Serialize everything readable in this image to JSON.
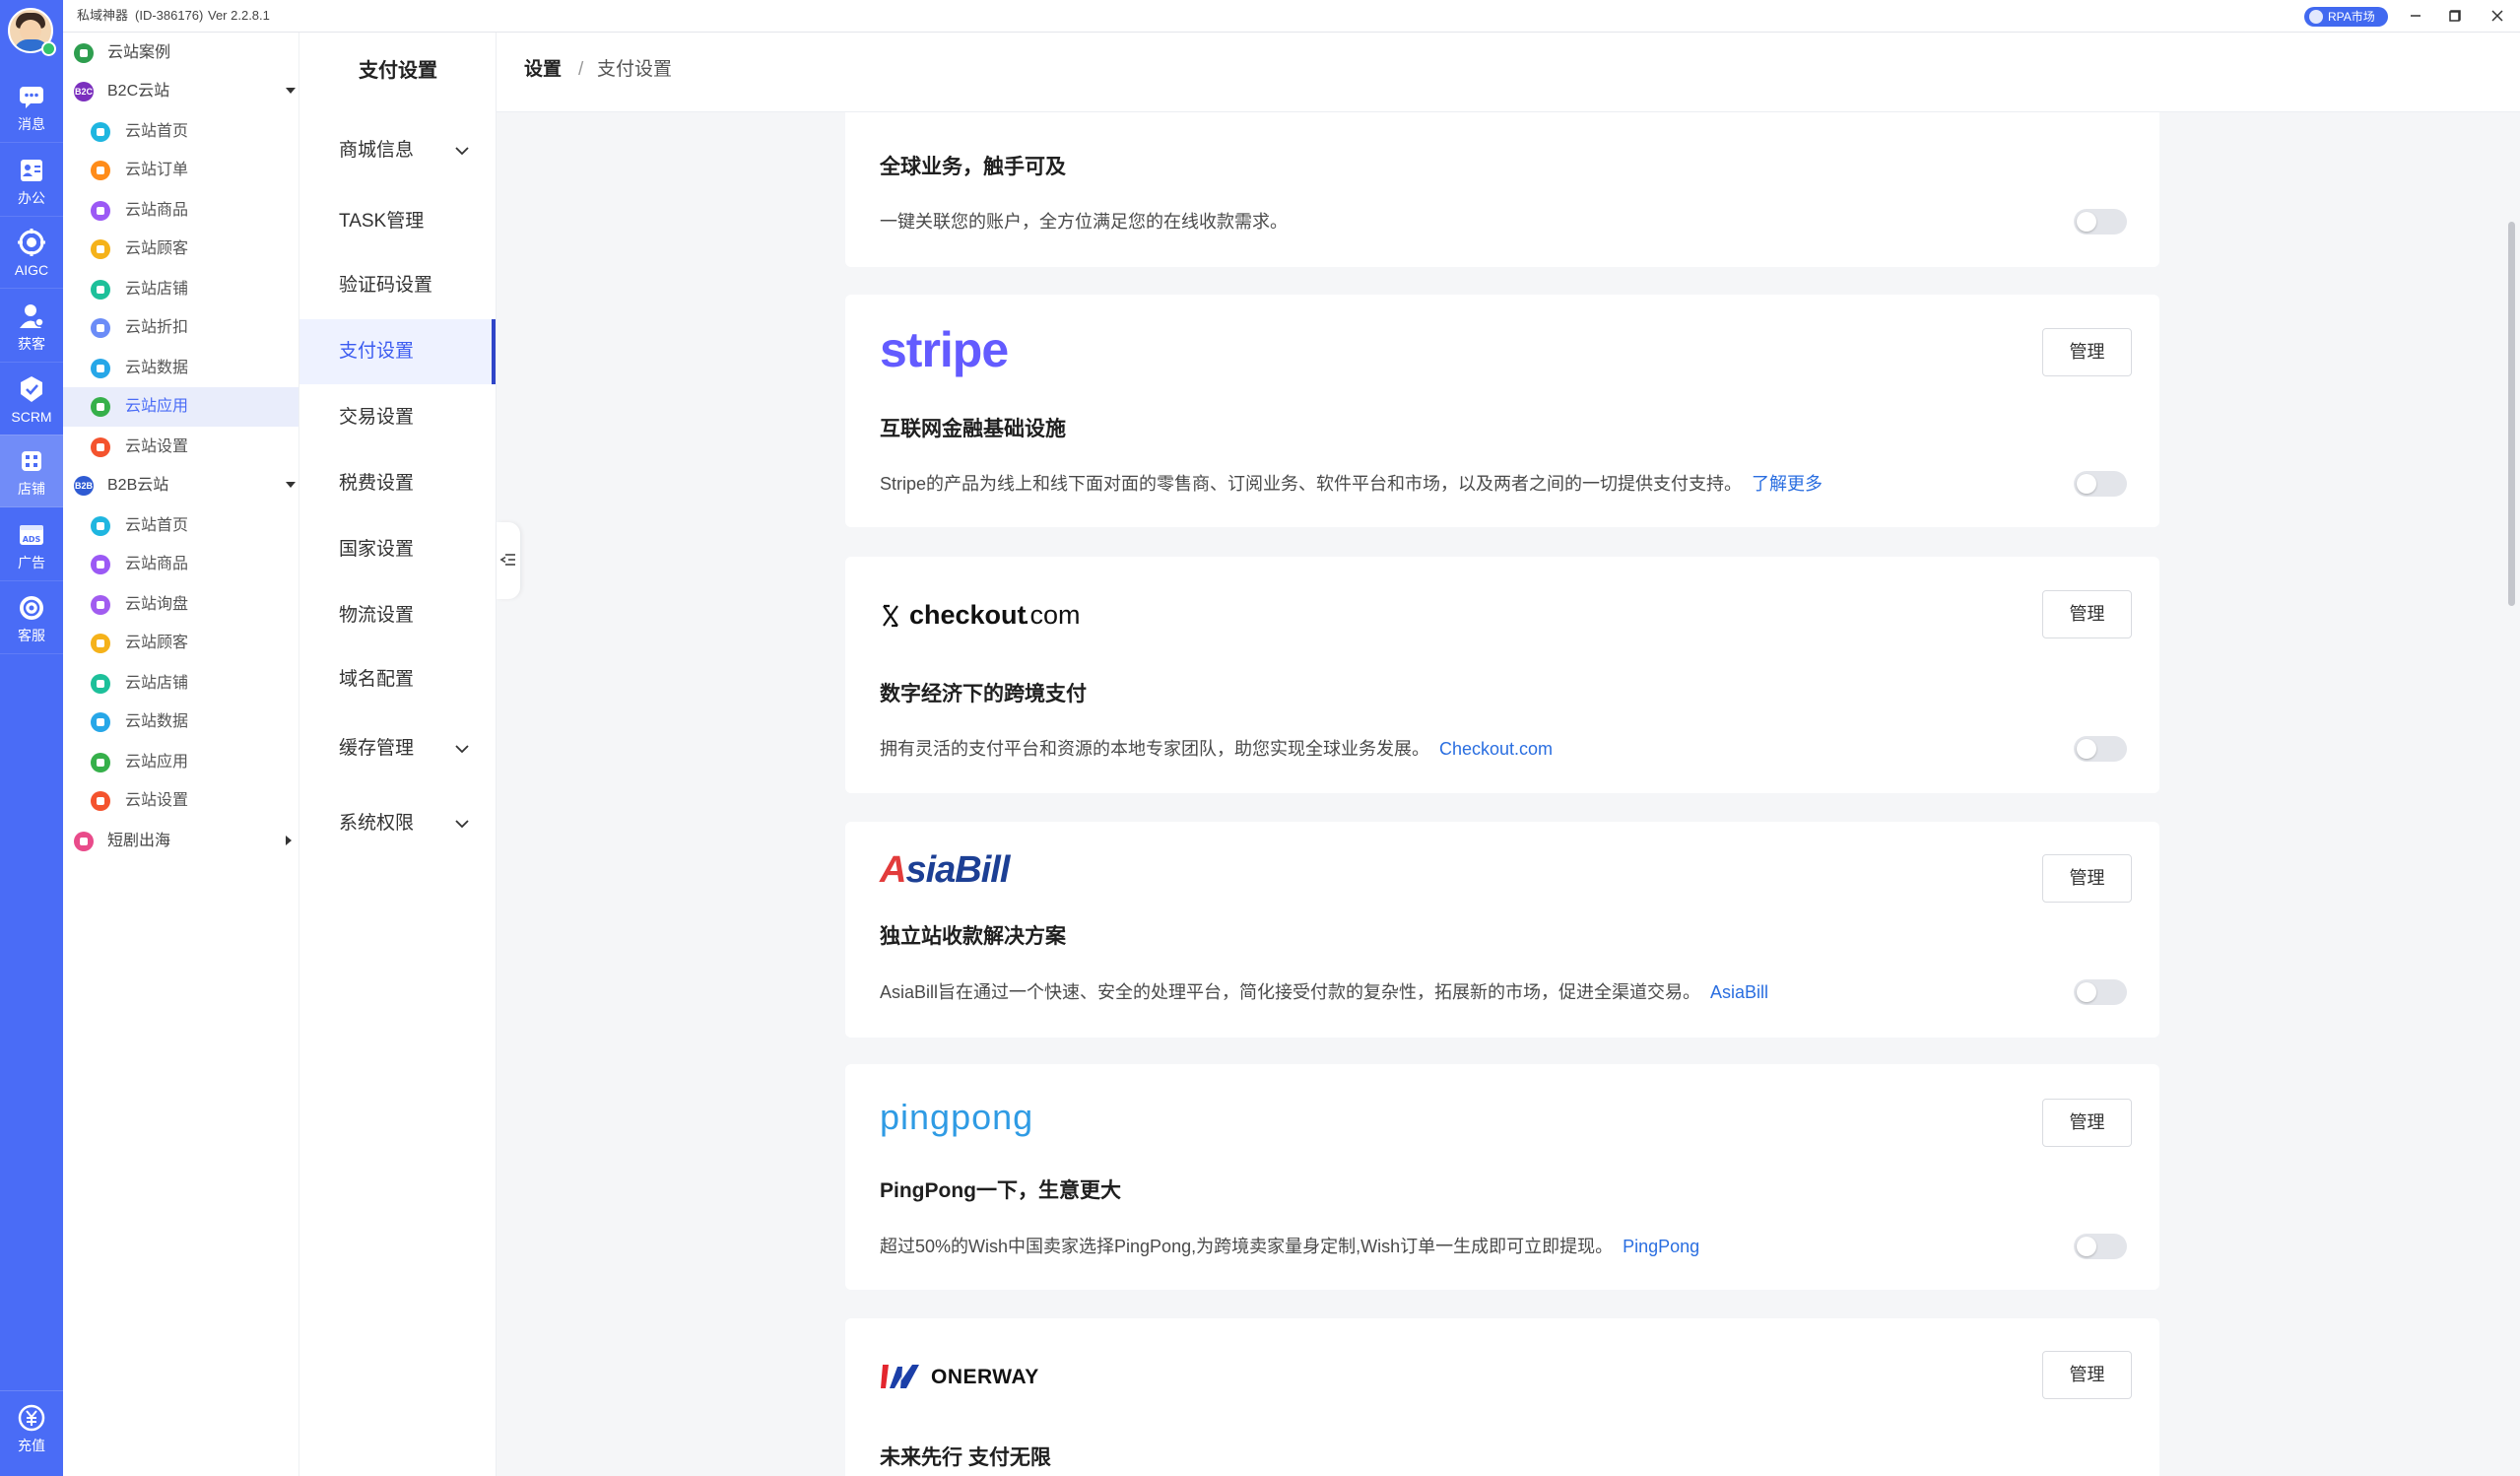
{
  "titlebar": {
    "app_name": "私域神器",
    "app_id": "(ID-386176)",
    "version": "Ver 2.2.8.1",
    "rpa_market": "RPA市场"
  },
  "icon_rail": {
    "items": [
      {
        "label": "消息",
        "icon": "message-icon"
      },
      {
        "label": "办公",
        "icon": "office-icon"
      },
      {
        "label": "AIGC",
        "icon": "aigc-icon"
      },
      {
        "label": "获客",
        "icon": "customer-acquisition-icon"
      },
      {
        "label": "SCRM",
        "icon": "scrm-icon"
      },
      {
        "label": "店铺",
        "icon": "store-icon",
        "active": true
      },
      {
        "label": "广告",
        "icon": "ads-icon"
      },
      {
        "label": "客服",
        "icon": "customer-service-icon"
      }
    ],
    "bottom": {
      "label": "充值",
      "icon": "recharge-icon"
    }
  },
  "tree": {
    "items": [
      {
        "label": "云站案例",
        "color": "#2e9e4f"
      },
      {
        "label": "B2C云站",
        "color": "#7b2fbe",
        "badge": "B2C",
        "expanded": true
      },
      {
        "label": "云站首页",
        "color": "#1fb6e0"
      },
      {
        "label": "云站订单",
        "color": "#ff8c1a"
      },
      {
        "label": "云站商品",
        "color": "#9b59f5"
      },
      {
        "label": "云站顾客",
        "color": "#f5b21a"
      },
      {
        "label": "云站店铺",
        "color": "#1dc09a"
      },
      {
        "label": "云站折扣",
        "color": "#6b8cf7"
      },
      {
        "label": "云站数据",
        "color": "#27a7e8"
      },
      {
        "label": "云站应用",
        "color": "#36b04a",
        "active": true
      },
      {
        "label": "云站设置",
        "color": "#f4532e"
      },
      {
        "label": "B2B云站",
        "color": "#2f5bd3",
        "badge": "B2B",
        "expanded": true
      },
      {
        "label": "云站首页",
        "color": "#1fb6e0"
      },
      {
        "label": "云站商品",
        "color": "#9b59f5"
      },
      {
        "label": "云站询盘",
        "color": "#a15cf0"
      },
      {
        "label": "云站顾客",
        "color": "#f5b21a"
      },
      {
        "label": "云站店铺",
        "color": "#1dc09a"
      },
      {
        "label": "云站数据",
        "color": "#27a7e8"
      },
      {
        "label": "云站应用",
        "color": "#36b04a"
      },
      {
        "label": "云站设置",
        "color": "#f4532e"
      },
      {
        "label": "短剧出海",
        "color": "#e94b8a",
        "expanded": false
      }
    ]
  },
  "settings_nav": {
    "title": "支付设置",
    "items": [
      {
        "label": "商城信息",
        "expandable": true
      },
      {
        "label": "TASK管理"
      },
      {
        "label": "验证码设置"
      },
      {
        "label": "支付设置",
        "active": true
      },
      {
        "label": "交易设置"
      },
      {
        "label": "税费设置"
      },
      {
        "label": "国家设置"
      },
      {
        "label": "物流设置"
      },
      {
        "label": "域名配置"
      },
      {
        "label": "缓存管理",
        "expandable": true
      },
      {
        "label": "系统权限",
        "expandable": true
      }
    ]
  },
  "breadcrumb": {
    "root": "设置",
    "separator": "/",
    "current": "支付设置"
  },
  "cards": [
    {
      "title": "全球业务，触手可及",
      "desc": "一键关联您的账户，全方位满足您的在线收款需求。",
      "enabled": false
    },
    {
      "logo": "stripe",
      "title": "互联网金融基础设施",
      "desc": "Stripe的产品为线上和线下面对面的零售商、订阅业务、软件平台和市场，以及两者之间的一切提供支付支持。",
      "link": "了解更多",
      "manage": "管理",
      "enabled": false
    },
    {
      "logo_main": "checkout",
      "logo_suffix": ".com",
      "title": "数字经济下的跨境支付",
      "desc": "拥有灵活的支付平台和资源的本地专家团队，助您实现全球业务发展。",
      "link": "Checkout.com",
      "manage": "管理",
      "enabled": false
    },
    {
      "logo_first": "A",
      "logo_rest": "siaBill",
      "title": "独立站收款解决方案",
      "desc": "AsiaBill旨在通过一个快速、安全的处理平台，简化接受付款的复杂性，拓展新的市场，促进全渠道交易。",
      "link": "AsiaBill",
      "manage": "管理",
      "enabled": false
    },
    {
      "logo": "pingpong",
      "title": "PingPong一下，生意更大",
      "desc": "超过50%的Wish中国卖家选择PingPong,为跨境卖家量身定制,Wish订单一生成即可立即提现。",
      "link": "PingPong",
      "manage": "管理",
      "enabled": false
    },
    {
      "logo": "ONERWAY",
      "title": "未来先行 支付无限",
      "manage": "管理"
    }
  ],
  "colors": {
    "rail_bg": "#4a6cf6",
    "accent": "#3b5bf0",
    "link": "#2a6ee0",
    "stripe_brand": "#635bff",
    "pingpong_brand": "#2f9be4",
    "asiabill_red": "#e23b3b",
    "asiabill_navy": "#1c3f94"
  }
}
